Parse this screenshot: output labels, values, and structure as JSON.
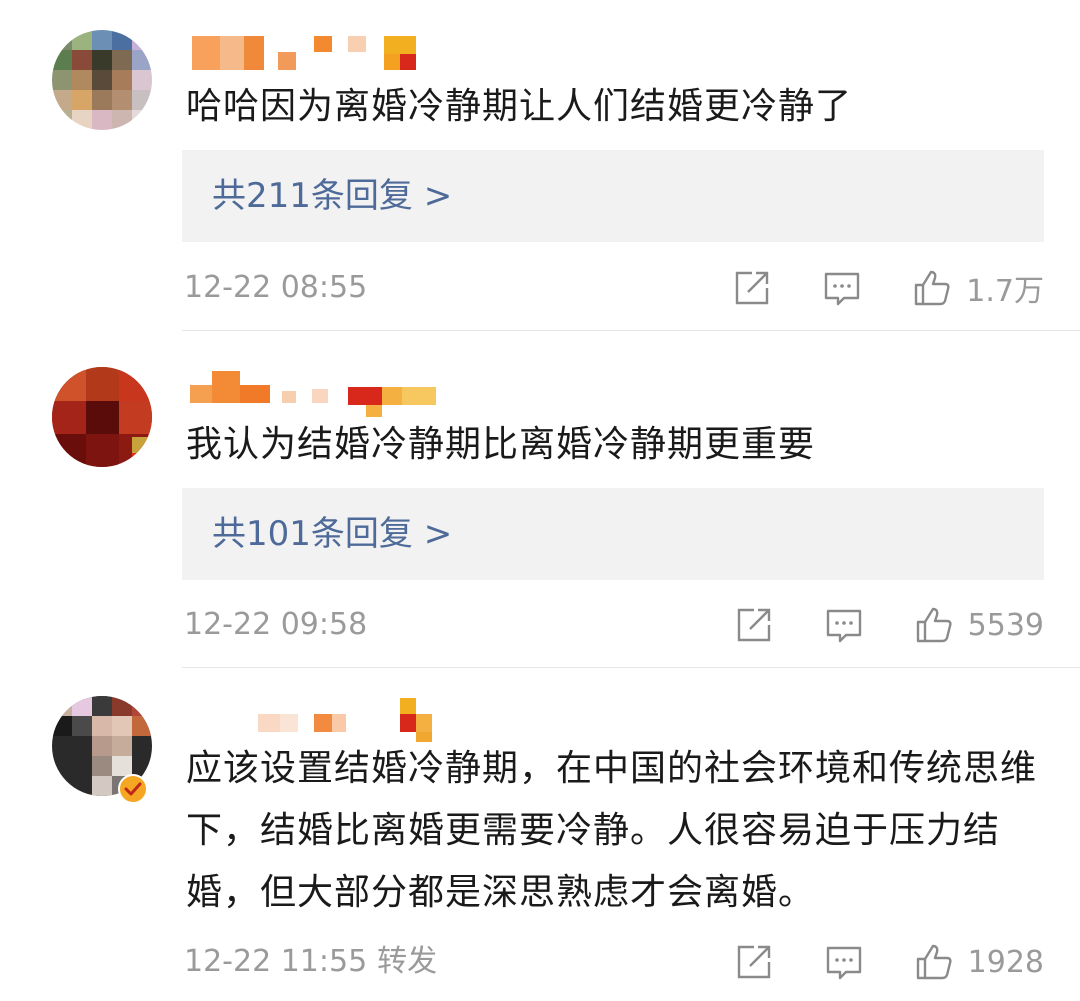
{
  "comments": [
    {
      "text": "哈哈因为离婚冷静期让人们结婚更冷静了",
      "replies_label": "共211条回复 >",
      "time": "12-22 08:55",
      "repost": "",
      "likes": "1.7万"
    },
    {
      "text": "我认为结婚冷静期比离婚冷静期更重要",
      "replies_label": "共101条回复 >",
      "time": "12-22 09:58",
      "repost": "",
      "likes": "5539"
    },
    {
      "text": "应该设置结婚冷静期，在中国的社会环境和传统思维下，结婚比离婚更需要冷静。人很容易迫于压力结婚，但大部分都是深思熟虑才会离婚。",
      "replies_label": "",
      "time": "12-22 11:55",
      "repost": "转发",
      "likes": "1928"
    }
  ],
  "icons": {
    "share": "share-icon",
    "reply": "comment-icon",
    "like": "thumbs-up-icon"
  },
  "colors": {
    "reply_link": "#4e6a99",
    "reply_box_bg": "#f2f2f2",
    "meta_text": "#9a9a9a",
    "body_text": "#1a1a1a"
  }
}
